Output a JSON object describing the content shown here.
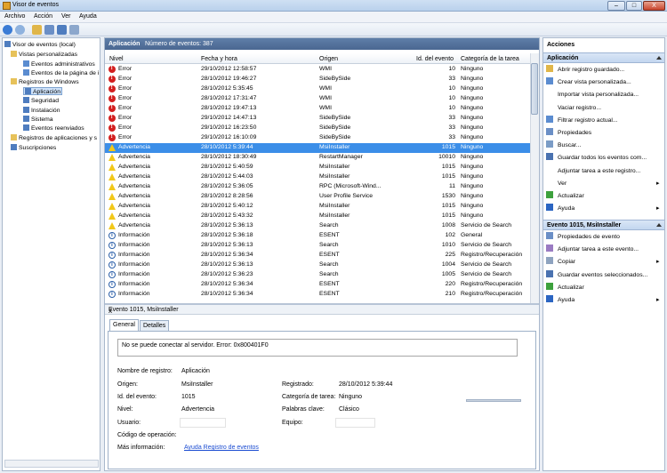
{
  "window": {
    "title": "Visor de eventos",
    "buttons": [
      "–",
      "□",
      "X"
    ]
  },
  "menu": [
    "Archivo",
    "Acción",
    "Ver",
    "Ayuda"
  ],
  "tree": [
    {
      "label": "Visor de eventos (local)",
      "level": 0,
      "icon": "log-icon"
    },
    {
      "label": "Vistas personalizadas",
      "level": 1,
      "icon": "folder-icon"
    },
    {
      "label": "Eventos administrativos",
      "level": 2,
      "icon": "filter-icon"
    },
    {
      "label": "Eventos de la página de i",
      "level": 2,
      "icon": "filter-icon"
    },
    {
      "label": "Registros de Windows",
      "level": 1,
      "icon": "folder-icon"
    },
    {
      "label": "Aplicación",
      "level": 2,
      "icon": "log-icon",
      "selected": true
    },
    {
      "label": "Seguridad",
      "level": 2,
      "icon": "log-icon"
    },
    {
      "label": "Instalación",
      "level": 2,
      "icon": "log-icon"
    },
    {
      "label": "Sistema",
      "level": 2,
      "icon": "log-icon"
    },
    {
      "label": "Eventos reenviados",
      "level": 2,
      "icon": "log-icon"
    },
    {
      "label": "Registros de aplicaciones y s",
      "level": 1,
      "icon": "folder-icon"
    },
    {
      "label": "Suscripciones",
      "level": 1,
      "icon": "log-icon"
    }
  ],
  "list": {
    "header_title": "Aplicación",
    "header_count": "Número de eventos: 387",
    "columns": [
      "Nivel",
      "Fecha y hora",
      "Origen",
      "Id. del evento",
      "Categoría de la tarea"
    ],
    "rows": [
      {
        "level": "Error",
        "type": "err",
        "date": "29/10/2012 12:58:57",
        "source": "WMI",
        "id": "10",
        "cat": "Ninguno"
      },
      {
        "level": "Error",
        "type": "err",
        "date": "28/10/2012 19:46:27",
        "source": "SideBySide",
        "id": "33",
        "cat": "Ninguno"
      },
      {
        "level": "Error",
        "type": "err",
        "date": "28/10/2012 5:35:45",
        "source": "WMI",
        "id": "10",
        "cat": "Ninguno"
      },
      {
        "level": "Error",
        "type": "err",
        "date": "28/10/2012 17:31:47",
        "source": "WMI",
        "id": "10",
        "cat": "Ninguno"
      },
      {
        "level": "Error",
        "type": "err",
        "date": "28/10/2012 19:47:13",
        "source": "WMI",
        "id": "10",
        "cat": "Ninguno"
      },
      {
        "level": "Error",
        "type": "err",
        "date": "29/10/2012 14:47:13",
        "source": "SideBySide",
        "id": "33",
        "cat": "Ninguno"
      },
      {
        "level": "Error",
        "type": "err",
        "date": "29/10/2012 16:23:50",
        "source": "SideBySide",
        "id": "33",
        "cat": "Ninguno"
      },
      {
        "level": "Error",
        "type": "err",
        "date": "29/10/2012 16:10:09",
        "source": "SideBySide",
        "id": "33",
        "cat": "Ninguno"
      },
      {
        "level": "Advertencia",
        "type": "warn",
        "date": "28/10/2012 5:39:44",
        "source": "MsiInstaller",
        "id": "1015",
        "cat": "Ninguno",
        "selected": true
      },
      {
        "level": "Advertencia",
        "type": "warn",
        "date": "28/10/2012 18:30:49",
        "source": "RestartManager",
        "id": "10010",
        "cat": "Ninguno"
      },
      {
        "level": "Advertencia",
        "type": "warn",
        "date": "28/10/2012 5:40:59",
        "source": "MsiInstaller",
        "id": "1015",
        "cat": "Ninguno"
      },
      {
        "level": "Advertencia",
        "type": "warn",
        "date": "28/10/2012 5:44:03",
        "source": "MsiInstaller",
        "id": "1015",
        "cat": "Ninguno"
      },
      {
        "level": "Advertencia",
        "type": "warn",
        "date": "28/10/2012 5:36:05",
        "source": "RPC (Microsoft-Wind...",
        "id": "11",
        "cat": "Ninguno"
      },
      {
        "level": "Advertencia",
        "type": "warn",
        "date": "28/10/2012 8:28:56",
        "source": "User Profile Service",
        "id": "1530",
        "cat": "Ninguno"
      },
      {
        "level": "Advertencia",
        "type": "warn",
        "date": "28/10/2012 5:40:12",
        "source": "MsiInstaller",
        "id": "1015",
        "cat": "Ninguno"
      },
      {
        "level": "Advertencia",
        "type": "warn",
        "date": "28/10/2012 5:43:32",
        "source": "MsiInstaller",
        "id": "1015",
        "cat": "Ninguno"
      },
      {
        "level": "Advertencia",
        "type": "warn",
        "date": "28/10/2012 5:36:13",
        "source": "Search",
        "id": "1008",
        "cat": "Servicio de Search"
      },
      {
        "level": "Información",
        "type": "info",
        "date": "28/10/2012 5:36:18",
        "source": "ESENT",
        "id": "102",
        "cat": "General"
      },
      {
        "level": "Información",
        "type": "info",
        "date": "28/10/2012 5:36:13",
        "source": "Search",
        "id": "1010",
        "cat": "Servicio de Search"
      },
      {
        "level": "Información",
        "type": "info",
        "date": "28/10/2012 5:36:34",
        "source": "ESENT",
        "id": "225",
        "cat": "Registro/Recuperación"
      },
      {
        "level": "Información",
        "type": "info",
        "date": "28/10/2012 5:36:13",
        "source": "Search",
        "id": "1004",
        "cat": "Servicio de Search"
      },
      {
        "level": "Información",
        "type": "info",
        "date": "28/10/2012 5:36:23",
        "source": "Search",
        "id": "1005",
        "cat": "Servicio de Search"
      },
      {
        "level": "Información",
        "type": "info",
        "date": "28/10/2012 5:36:34",
        "source": "ESENT",
        "id": "220",
        "cat": "Registro/Recuperación"
      },
      {
        "level": "Información",
        "type": "info",
        "date": "28/10/2012 5:36:34",
        "source": "ESENT",
        "id": "210",
        "cat": "Registro/Recuperación"
      }
    ]
  },
  "details": {
    "title": "Evento 1015, MsiInstaller",
    "close": "x",
    "tabs": [
      "General",
      "Detalles"
    ],
    "message": "No se puede conectar al servidor. Error: 0x800401F0",
    "fields": {
      "log_name_label": "Nombre de registro:",
      "log_name": "Aplicación",
      "source_label": "Origen:",
      "source": "MsiInstaller",
      "logged_label": "Registrado:",
      "logged": "28/10/2012 5:39:44",
      "event_id_label": "Id. del evento:",
      "event_id": "1015",
      "task_cat_label": "Categoría de tarea:",
      "task_cat": "Ninguno",
      "level_label": "Nivel:",
      "level": "Advertencia",
      "keywords_label": "Palabras clave:",
      "keywords": "Clásico",
      "user_label": "Usuario:",
      "computer_label": "Equipo:",
      "opcode_label": "Código de operación:",
      "more_info_label": "Más información:",
      "more_info_link": "Ayuda Registro de eventos"
    }
  },
  "actions": {
    "title": "Acciones",
    "section1": "Aplicación",
    "items1": [
      {
        "label": "Abrir registro guardado...",
        "icon": "open-log-icon"
      },
      {
        "label": "Crear vista personalizada...",
        "icon": "filter-icon"
      },
      {
        "label": "Importar vista personalizada...",
        "icon": ""
      },
      {
        "label": "Vaciar registro...",
        "icon": ""
      },
      {
        "label": "Filtrar registro actual...",
        "icon": "filter-icon"
      },
      {
        "label": "Propiedades",
        "icon": "properties-icon"
      },
      {
        "label": "Buscar...",
        "icon": "find-icon"
      },
      {
        "label": "Guardar todos los eventos com...",
        "icon": "save-icon"
      },
      {
        "label": "Adjuntar tarea a este registro...",
        "icon": ""
      },
      {
        "label": "Ver",
        "icon": "",
        "arrow": true
      },
      {
        "label": "Actualizar",
        "icon": "refresh-icon"
      },
      {
        "label": "Ayuda",
        "icon": "help-icon",
        "arrow": true
      }
    ],
    "section2": "Evento 1015, MsiInstaller",
    "items2": [
      {
        "label": "Propiedades de evento",
        "icon": "properties-icon"
      },
      {
        "label": "Adjuntar tarea a este evento...",
        "icon": "task-icon"
      },
      {
        "label": "Copiar",
        "icon": "copy-icon",
        "arrow": true
      },
      {
        "label": "Guardar eventos seleccionados...",
        "icon": "save-icon"
      },
      {
        "label": "Actualizar",
        "icon": "refresh-icon"
      },
      {
        "label": "Ayuda",
        "icon": "help-icon",
        "arrow": true
      }
    ]
  }
}
